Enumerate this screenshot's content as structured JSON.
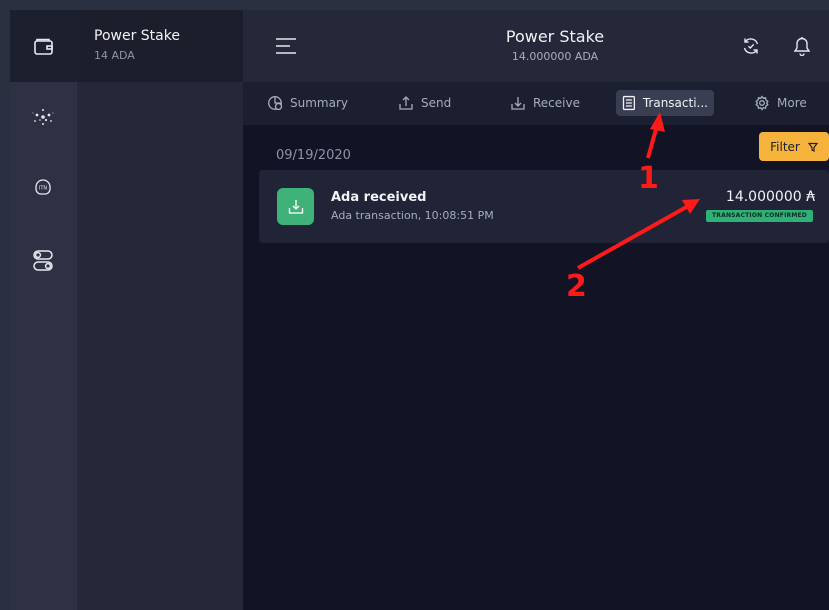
{
  "wallets": {
    "selected": {
      "name": "Power Stake",
      "balance": "14 ADA"
    }
  },
  "rail": {
    "icons": [
      "wallet-icon",
      "network-icon",
      "itn-icon",
      "toggle-icon"
    ]
  },
  "header": {
    "title": "Power Stake",
    "subtitle": "14.000000 ADA",
    "menu_icon": "hamburger-icon",
    "sync_icon": "sync-icon",
    "bell_icon": "bell-icon"
  },
  "tabs": [
    {
      "label": "Summary",
      "icon": "summary-icon"
    },
    {
      "label": "Send",
      "icon": "send-icon"
    },
    {
      "label": "Receive",
      "icon": "receive-icon"
    },
    {
      "label": "Transacti...",
      "icon": "transactions-icon",
      "active": true
    },
    {
      "label": "More",
      "icon": "gear-icon"
    }
  ],
  "filter": {
    "label": "Filter"
  },
  "transactions": {
    "date": "09/19/2020",
    "items": [
      {
        "title": "Ada received",
        "description": "Ada transaction, 10:08:51 PM",
        "amount": "14.000000 ₳",
        "status": "TRANSACTION CONFIRMED"
      }
    ]
  },
  "annotations": {
    "marker1": "1",
    "marker2": "2",
    "color": "#ff1a1a"
  },
  "colors": {
    "accent_filter": "#f6b33b",
    "received": "#3fb27a",
    "confirmed": "#2fb077"
  }
}
